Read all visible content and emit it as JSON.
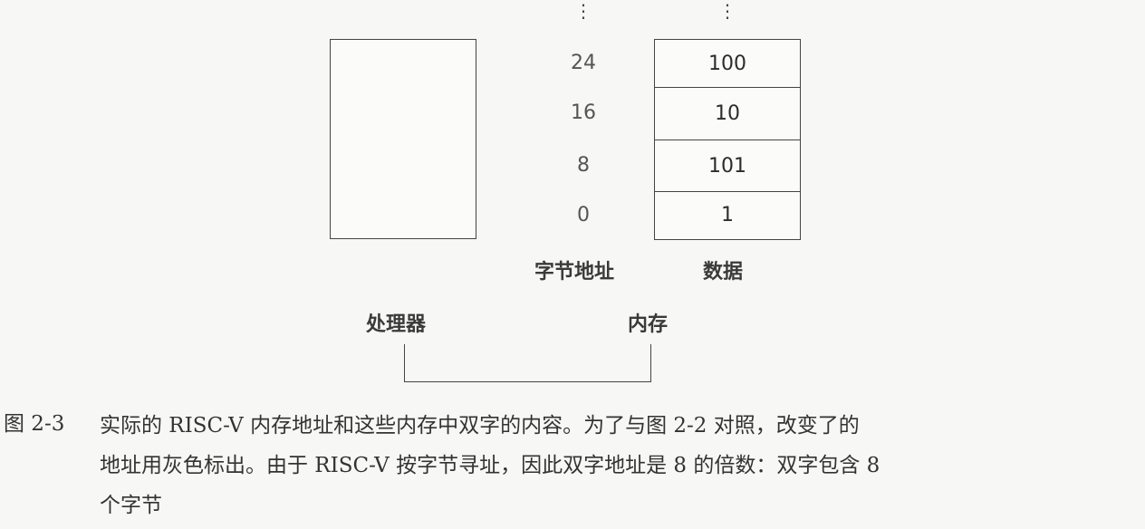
{
  "diagram": {
    "processor_label": "处理器",
    "memory_label": "内存",
    "address_column_label": "字节地址",
    "data_column_label": "数据",
    "continuation_mark": "⋮",
    "addresses": [
      "24",
      "16",
      "8",
      "0"
    ],
    "data": [
      "100",
      "10",
      "101",
      "1"
    ]
  },
  "caption": {
    "figure_number": "图 2-3",
    "lines": [
      "实际的 RISC-V 内存地址和这些内存中双字的内容。为了与图 2-2 对照，改变了的",
      "地址用灰色标出。由于 RISC-V 按字节寻址，因此双字地址是 8 的倍数：双字包含 8",
      "个字节"
    ]
  }
}
